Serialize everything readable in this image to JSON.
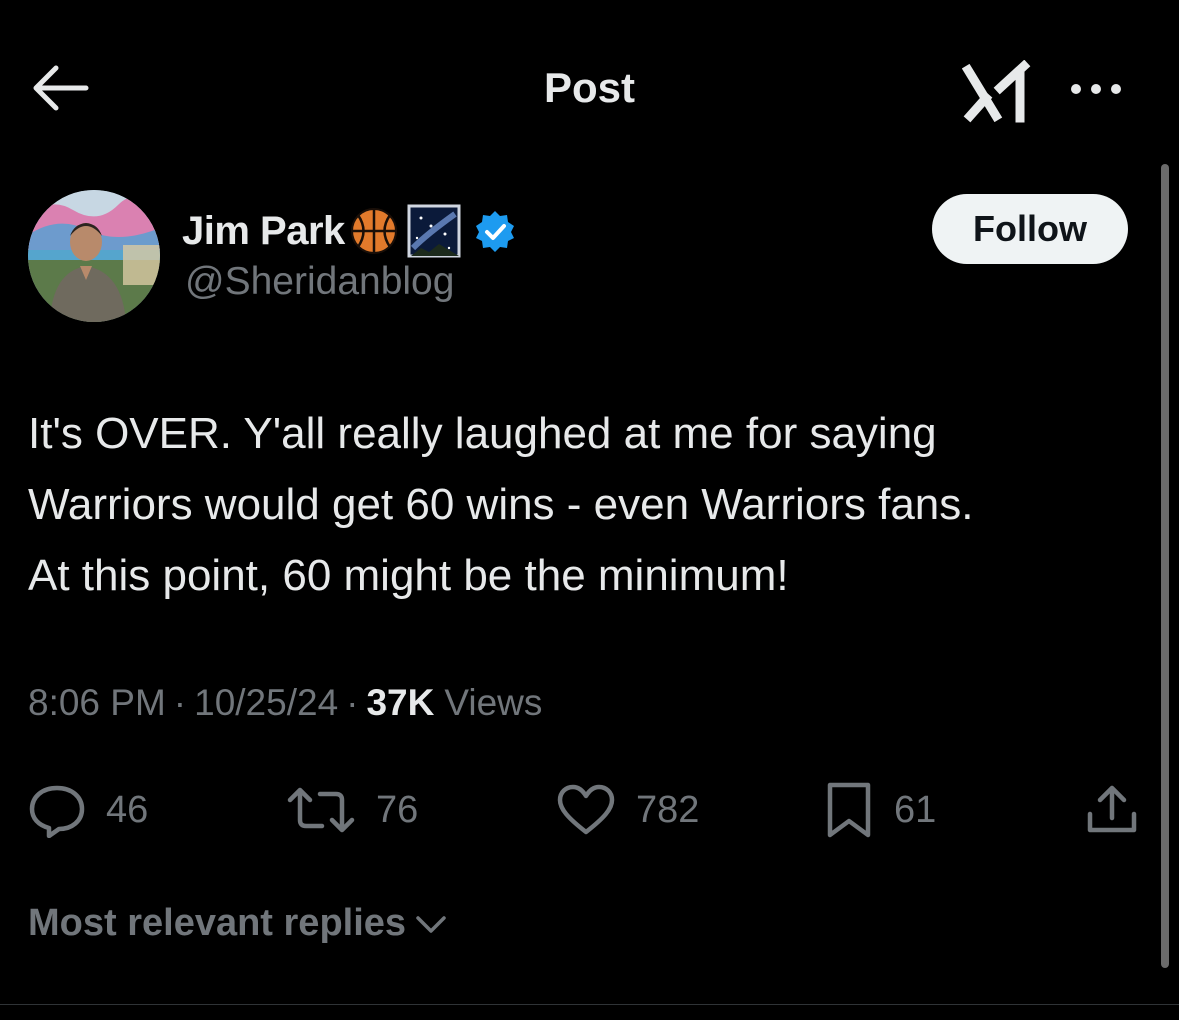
{
  "header": {
    "title": "Post",
    "back_icon": "arrow-left-icon",
    "grok_icon": "grok-logo-icon",
    "more_icon": "more-horizontal-icon"
  },
  "author": {
    "name": "Jim Park",
    "name_emojis": [
      "🏀",
      "🌌"
    ],
    "handle": "@Sheridanblog",
    "verified": true,
    "verified_color": "#1d9bf0"
  },
  "follow_button": {
    "label": "Follow"
  },
  "post": {
    "lines": [
      "It's OVER. Y'all really laughed at me for saying",
      "Warriors would get 60 wins - even Warriors fans.",
      "At this point, 60 might be the minimum!"
    ],
    "time": "8:06 PM",
    "date": "10/25/24",
    "views_count": "37K",
    "views_label": "Views",
    "separator": "·"
  },
  "actions": {
    "replies": "46",
    "reposts": "76",
    "likes": "782",
    "bookmarks": "61"
  },
  "replies_sort": {
    "label": "Most relevant replies"
  },
  "colors": {
    "background": "#000000",
    "text": "#e7e9ea",
    "secondary": "#71767b",
    "follow_bg": "#eff3f4"
  }
}
